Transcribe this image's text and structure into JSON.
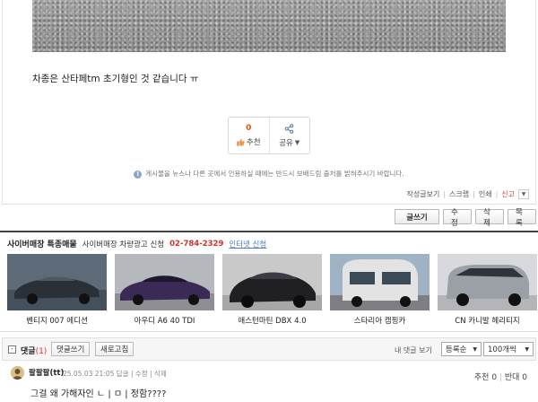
{
  "post": {
    "body_text": "차종은 산타페tm 초기형인 것 같습니다 ㅠ",
    "recommend_count": "0",
    "recommend_label": "추천",
    "share_label": "공유",
    "notice": "게시물을 뉴스나 다른 곳에서 인용하실 때에는 반드시 보배드림 출처를 밝혀주시기 바랍니다.",
    "tools": [
      "작성글보기",
      "스크랩",
      "인쇄",
      "신고"
    ]
  },
  "actions": {
    "write": "글쓰기",
    "edit": "수정",
    "delete": "삭제",
    "list": "목록"
  },
  "store": {
    "title": "사이버매장 특종매물",
    "ad_text": "사이버매장 차량광고 신청",
    "phone": "02-784-2329",
    "online_link": "인터넷 신청",
    "cars": [
      {
        "name": "벤티지 007 에디션",
        "color": "#2b2f36"
      },
      {
        "name": "아우디 A6 40 TDI",
        "color": "#3a2a55"
      },
      {
        "name": "애스턴마틴 DBX 4.0",
        "color": "#1f1f24"
      },
      {
        "name": "스타리아 캠핑카",
        "color": "#d8d8d8"
      },
      {
        "name": "CN 카니발 헤리티지",
        "color": "#9aa0a6"
      }
    ]
  },
  "comments": {
    "toggle": "-",
    "title": "댓글",
    "count": "(1)",
    "write_button": "댓글쓰기",
    "refresh_button": "새로고침",
    "my_comments": "내 댓글 보기",
    "sort_selected": "등록순",
    "per_page_selected": "100개씩",
    "items": [
      {
        "author": "팔팔팔(tt)",
        "meta": "25.05.03 21:05  답글 | 수정 | 삭제",
        "recommend": "추천 0",
        "oppose": "반대 0",
        "text": "그걸 왜 가해자인 ㄴ | ㅁ | 정함????"
      }
    ]
  }
}
